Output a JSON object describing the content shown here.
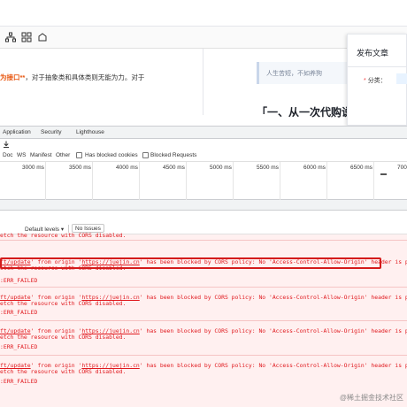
{
  "editor": {
    "text_highlight": "为接口**",
    "text_rest": "，对于抽象类和具体类则无能为力。对于"
  },
  "preview": {
    "quote": "人生苦短，不如养狗",
    "heading": "「一、从一次代购说"
  },
  "publish_panel": {
    "title": "发布文章",
    "required_mark": "*",
    "category_label": "分类："
  },
  "devtools": {
    "tabs": [
      "Application",
      "Security",
      "Lighthouse"
    ],
    "filters": [
      "Doc",
      "WS",
      "Manifest",
      "Other"
    ],
    "checkboxes": [
      "Has blocked cookies",
      "Blocked Requests"
    ],
    "timeline_ticks": [
      "3000 ms",
      "3500 ms",
      "4000 ms",
      "4500 ms",
      "5000 ms",
      "5500 ms",
      "6000 ms",
      "6500 ms",
      "700"
    ]
  },
  "console": {
    "level_selector": "Default levels ▾",
    "issues_button": "No Issues",
    "top_partial": "etch the resource with CORS disabled.",
    "entries": [
      {
        "url_part": "ft/update",
        "message_a": "' from origin '",
        "origin": "https://juejin.cn",
        "message_b": "' has been blocked by CORS policy: No 'Access-Control-Allow-Origin' header is pres",
        "cont": "etch the resource with CORS disabled.",
        "failed": ":ERR_FAILED"
      },
      {
        "url_part": "ft/update",
        "message_a": "' from origin '",
        "origin": "https://juejin.cn",
        "message_b": "' has been blocked by CORS policy: No 'Access-Control-Allow-Origin' header is pres",
        "cont": "etch the resource with CORS disabled.",
        "failed": ":ERR_FAILED"
      },
      {
        "url_part": "ft/update",
        "message_a": "' from origin '",
        "origin": "https://juejin.cn",
        "message_b": "' has been blocked by CORS policy: No 'Access-Control-Allow-Origin' header is pres",
        "cont": "etch the resource with CORS disabled.",
        "failed": ":ERR_FAILED"
      },
      {
        "url_part": "ft/update",
        "message_a": "' from origin '",
        "origin": "https://juejin.cn",
        "message_b": "' has been blocked by CORS policy: No 'Access-Control-Allow-Origin' header is pres",
        "cont": "etch the resource with CORS disabled.",
        "failed": ":ERR_FAILED"
      }
    ]
  },
  "watermark": "@稀土掘金技术社区",
  "colors": {
    "error_text": "#e0191e",
    "error_bg": "#fff0f0",
    "highlight_border": "#d41b1b",
    "accent_orange": "#e8560f"
  }
}
